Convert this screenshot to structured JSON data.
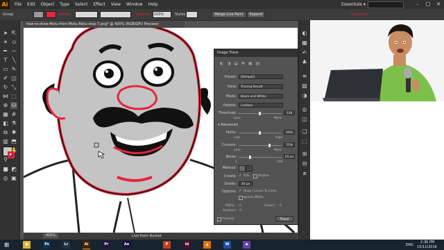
{
  "app": {
    "logo": "Ai"
  },
  "menu": [
    "File",
    "Edit",
    "Object",
    "Type",
    "Select",
    "Effect",
    "View",
    "Window",
    "Help"
  ],
  "workspace": {
    "label": "Essentials ▾"
  },
  "window_buttons": [
    "–",
    "□",
    "✕"
  ],
  "control_bar": {
    "selection": "Group",
    "stroke_label": "Stroke:",
    "opacity_label": "Opacity:",
    "opacity_value": "100%",
    "styles_label": "Styles:",
    "merge_btn": "Merge Live Paint",
    "expand_btn": "Expand",
    "transform_label": "Transform"
  },
  "document": {
    "tab_title": "how-to-draw-Motu-from-Motu-Patlu-step-7.png* @ 400% (RGB/GPU Preview)",
    "zoom": "400%",
    "status_tool": "Live Paint Bucket"
  },
  "image_trace": {
    "title": "Image Trace",
    "preset_label": "Preset:",
    "preset_value": "[Default]",
    "view_label": "View:",
    "view_value": "Tracing Result",
    "mode_label": "Mode:",
    "mode_value": "Black and White",
    "palette_label": "Palette:",
    "palette_value": "Limited",
    "threshold_label": "Threshold:",
    "threshold_value": "128",
    "threshold_less": "Less",
    "threshold_more": "More",
    "advanced_label": "Advanced",
    "paths_label": "Paths:",
    "paths_value": "50%",
    "paths_low": "Low",
    "paths_high": "High",
    "corners_label": "Corners:",
    "corners_value": "75%",
    "corners_less": "Less",
    "corners_more": "More",
    "noise_label": "Noise:",
    "noise_value": "25 px",
    "noise_min": "1",
    "noise_max": "100",
    "method_label": "Method:",
    "create_label": "Create:",
    "fills_label": "Fills",
    "strokes_label": "Strokes",
    "stroke_label": "Stroke:",
    "stroke_value": "10 px",
    "options_label": "Options:",
    "snap_label": "Snap Curves To Lines",
    "ignore_label": "Ignore White",
    "stat_paths_label": "Paths:",
    "stat_paths_value": "0",
    "stat_colors_label": "Colors:",
    "stat_colors_value": "0",
    "stat_anchors_label": "Anchors:",
    "stat_anchors_value": "0",
    "preview_label": "Preview",
    "trace_btn": "Trace"
  },
  "taskbar": {
    "apps": [
      {
        "name": "chrome",
        "glyph": "●",
        "color": "#e8b12a"
      },
      {
        "name": "photoshop",
        "glyph": "Ps",
        "color": "#0b3356"
      },
      {
        "name": "lightroom",
        "glyph": "Lr",
        "color": "#1f3147"
      },
      {
        "name": "illustrator",
        "glyph": "Ai",
        "color": "#4a2300"
      },
      {
        "name": "premiere",
        "glyph": "Pr",
        "color": "#2b0f44"
      },
      {
        "name": "after-effects",
        "glyph": "Ae",
        "color": "#1f0f44"
      },
      {
        "name": "powerpoint",
        "glyph": "P",
        "color": "#c1401f"
      },
      {
        "name": "indesign",
        "glyph": "Id",
        "color": "#4a0f2b"
      },
      {
        "name": "vlc",
        "glyph": "▲",
        "color": "#e07000"
      },
      {
        "name": "word",
        "glyph": "W",
        "color": "#1f4fa0"
      },
      {
        "name": "media",
        "glyph": "◆",
        "color": "#6a3fb0"
      }
    ],
    "language": "ENG",
    "time": "2:36 PM",
    "date": "15/11/2016"
  },
  "colors": {
    "accent_red": "#e3263b",
    "panel": "#535353",
    "dark": "#323232",
    "taskbar": "#17232f"
  }
}
